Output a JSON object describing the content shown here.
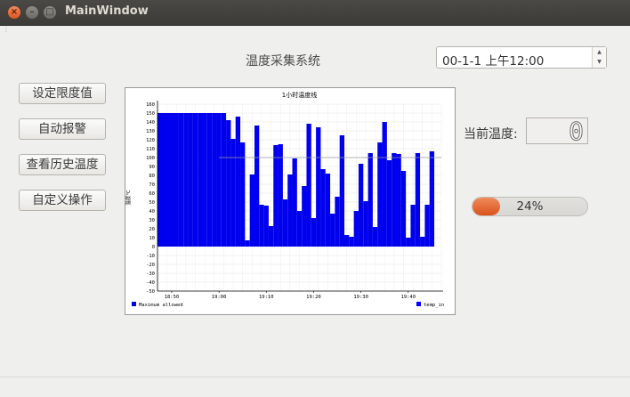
{
  "window": {
    "title": "MainWindow",
    "close_glyph": "×",
    "minimize_glyph": "–",
    "maximize_glyph": "□"
  },
  "header": {
    "system_title": "温度采集系统",
    "datetime_value": "00-1-1 上午12:00"
  },
  "sidebar": {
    "buttons": [
      {
        "label": "设定限度值"
      },
      {
        "label": "自动报警"
      },
      {
        "label": "查看历史温度"
      },
      {
        "label": "自定义操作"
      }
    ]
  },
  "status": {
    "current_temp_label": "当前温度:",
    "current_temp_value": "0",
    "progress_percent": 24,
    "progress_text": "24%"
  },
  "chart_data": {
    "type": "bar",
    "title": "1小时温度线",
    "ylabel": "温度℃",
    "xlabel": "",
    "ylim": [
      -50,
      160
    ],
    "y_ticks": [
      -50,
      -40,
      -30,
      -20,
      -10,
      0,
      10,
      20,
      30,
      40,
      50,
      60,
      70,
      80,
      90,
      100,
      110,
      120,
      130,
      140,
      150,
      160
    ],
    "x_tick_labels": [
      "18:50",
      "19:00",
      "19:10",
      "19:20",
      "19:30",
      "19:40"
    ],
    "reference_line": 100,
    "series": [
      {
        "name": "temp_in",
        "color": "#0000ee",
        "points": [
          {
            "x": "18:51",
            "y": 150
          },
          {
            "x": "18:52",
            "y": 150
          },
          {
            "x": "18:53",
            "y": 150
          },
          {
            "x": "18:54",
            "y": 150
          },
          {
            "x": "18:55",
            "y": 150
          },
          {
            "x": "18:56",
            "y": 150
          },
          {
            "x": "18:57",
            "y": 150
          },
          {
            "x": "18:58",
            "y": 150
          },
          {
            "x": "18:59",
            "y": 150
          },
          {
            "x": "19:00",
            "y": 150
          },
          {
            "x": "19:01",
            "y": 150
          },
          {
            "x": "19:02",
            "y": 142
          },
          {
            "x": "19:03",
            "y": 121
          },
          {
            "x": "19:04",
            "y": 146
          },
          {
            "x": "19:05",
            "y": 117
          },
          {
            "x": "19:06",
            "y": 7
          },
          {
            "x": "19:07",
            "y": 81
          },
          {
            "x": "19:08",
            "y": 136
          },
          {
            "x": "19:09",
            "y": 47
          },
          {
            "x": "19:10",
            "y": 46
          },
          {
            "x": "19:11",
            "y": 23
          },
          {
            "x": "19:12",
            "y": 114
          },
          {
            "x": "19:13",
            "y": 115
          },
          {
            "x": "19:14",
            "y": 53
          },
          {
            "x": "19:15",
            "y": 81
          },
          {
            "x": "19:16",
            "y": 99
          },
          {
            "x": "19:17",
            "y": 40
          },
          {
            "x": "19:18",
            "y": 68
          },
          {
            "x": "19:19",
            "y": 138
          },
          {
            "x": "19:20",
            "y": 32
          },
          {
            "x": "19:21",
            "y": 134
          },
          {
            "x": "19:22",
            "y": 87
          },
          {
            "x": "19:23",
            "y": 82
          },
          {
            "x": "19:24",
            "y": 37
          },
          {
            "x": "19:25",
            "y": 56
          },
          {
            "x": "19:26",
            "y": 125
          },
          {
            "x": "19:27",
            "y": 13
          },
          {
            "x": "19:28",
            "y": 11
          },
          {
            "x": "19:29",
            "y": 40
          },
          {
            "x": "19:30",
            "y": 93
          },
          {
            "x": "19:31",
            "y": 51
          },
          {
            "x": "19:32",
            "y": 105
          },
          {
            "x": "19:33",
            "y": 22
          },
          {
            "x": "19:34",
            "y": 117
          },
          {
            "x": "19:35",
            "y": 140
          },
          {
            "x": "19:36",
            "y": 97
          },
          {
            "x": "19:37",
            "y": 105
          },
          {
            "x": "19:38",
            "y": 104
          },
          {
            "x": "19:39",
            "y": 85
          },
          {
            "x": "19:40",
            "y": 10
          },
          {
            "x": "19:41",
            "y": 47
          },
          {
            "x": "19:42",
            "y": 105
          },
          {
            "x": "19:43",
            "y": 11
          },
          {
            "x": "19:44",
            "y": 47
          },
          {
            "x": "19:45",
            "y": 107
          }
        ]
      }
    ],
    "legend": [
      {
        "label": "Maximum allowed",
        "color": "#0000ee"
      },
      {
        "label": "temp_in",
        "color": "#0000ee"
      }
    ],
    "legend_placement": "bottom",
    "grid": true
  }
}
